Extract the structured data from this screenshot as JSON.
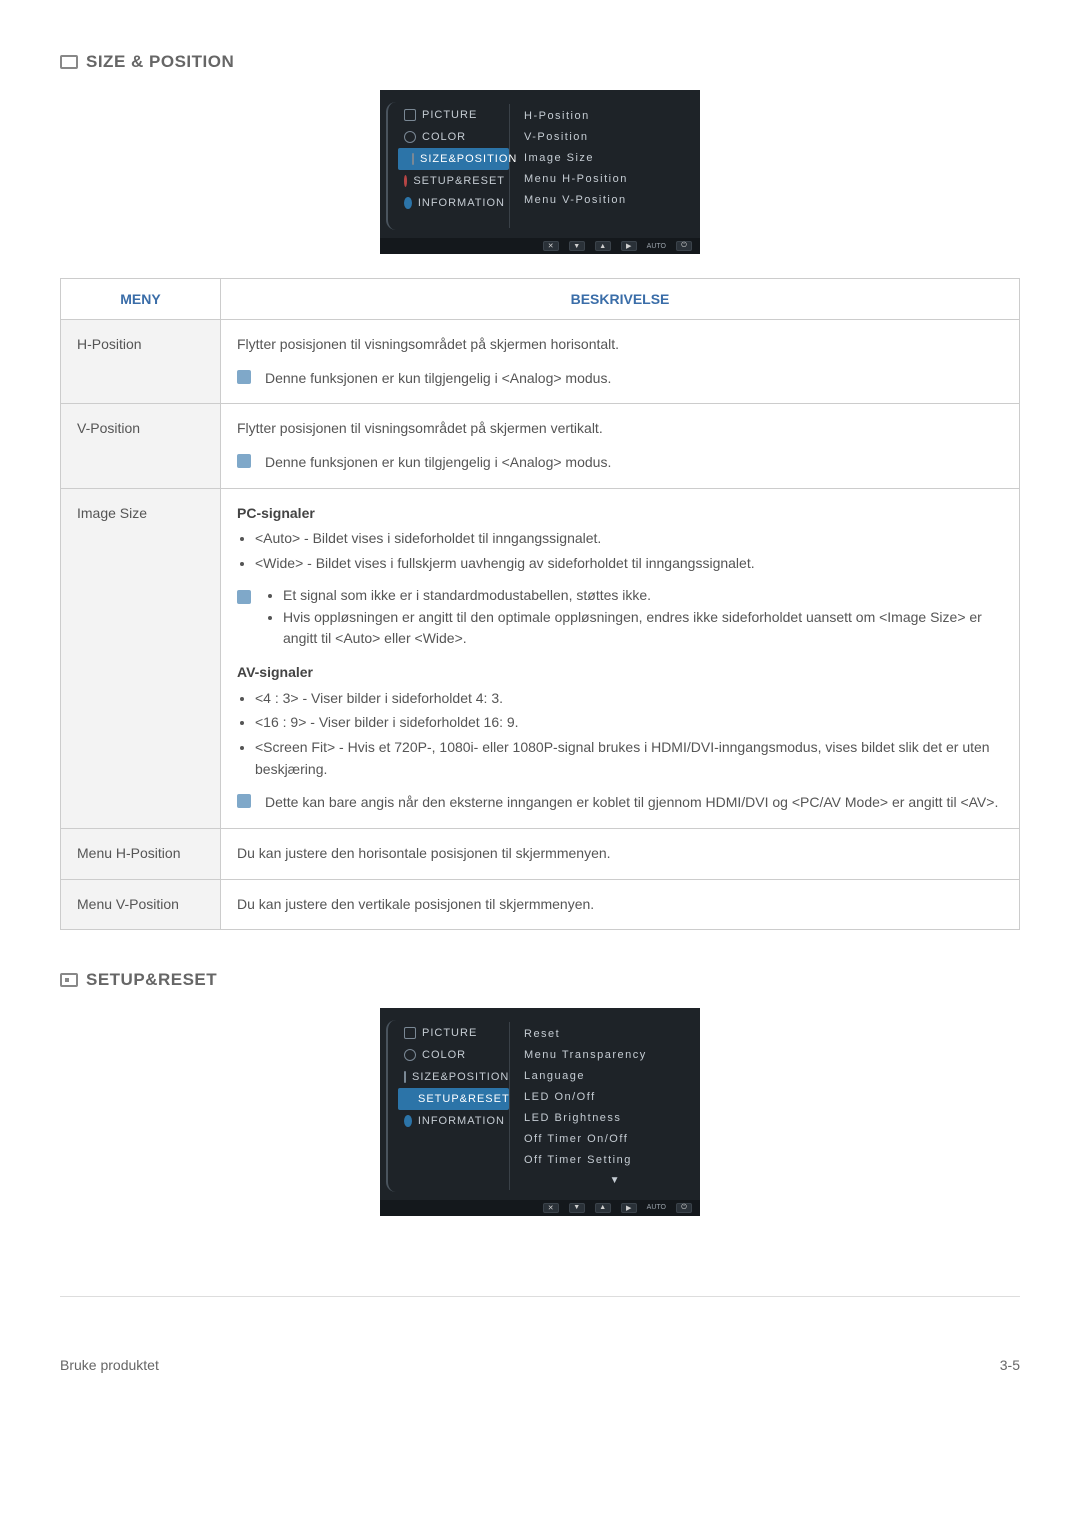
{
  "section1": {
    "title": "SIZE & POSITION"
  },
  "osd1": {
    "left": {
      "picture": "PICTURE",
      "color": "COLOR",
      "sizepos": "SIZE&POSITION",
      "setup": "SETUP&RESET",
      "info": "INFORMATION"
    },
    "right": {
      "hpos": "H-Position",
      "vpos": "V-Position",
      "imgsize": "Image Size",
      "menuh": "Menu H-Position",
      "menuv": "Menu V-Position"
    },
    "footer": {
      "auto": "AUTO"
    }
  },
  "table1": {
    "headers": {
      "meny": "MENY",
      "beskr": "BESKRIVELSE"
    },
    "rows": {
      "hpos": {
        "label": "H-Position",
        "text": "Flytter posisjonen til visningsområdet på skjermen horisontalt.",
        "note": "Denne funksjonen er kun tilgjengelig i <Analog> modus."
      },
      "vpos": {
        "label": "V-Position",
        "text": "Flytter posisjonen til visningsområdet på skjermen vertikalt.",
        "note": "Denne funksjonen er kun tilgjengelig i <Analog> modus."
      },
      "imgsize": {
        "label": "Image Size",
        "pc_header": "PC-signaler",
        "pc_b1": "<Auto> - Bildet vises i sideforholdet til inngangssignalet.",
        "pc_b2": "<Wide> - Bildet vises i fullskjerm uavhengig av sideforholdet til inngangssignalet.",
        "pc_n1": "Et signal som ikke er i standardmodustabellen, støttes ikke.",
        "pc_n2": "Hvis oppløsningen er angitt til den optimale oppløsningen, endres ikke sideforholdet uansett om <Image Size> er angitt til <Auto> eller <Wide>.",
        "av_header": "AV-signaler",
        "av_b1": "<4 : 3> - Viser bilder i sideforholdet 4: 3.",
        "av_b2": "<16 : 9> - Viser bilder i sideforholdet 16: 9.",
        "av_b3": "<Screen Fit> - Hvis et 720P-, 1080i- eller 1080P-signal brukes i HDMI/DVI-inngangsmodus, vises bildet slik det er uten beskjæring.",
        "av_note": "Dette kan bare angis når den eksterne inngangen er koblet til gjennom HDMI/DVI og <PC/AV Mode> er angitt til <AV>."
      },
      "menuh": {
        "label": "Menu H-Position",
        "text": "Du kan justere den horisontale posisjonen til skjermmenyen."
      },
      "menuv": {
        "label": "Menu V-Position",
        "text": "Du kan justere den vertikale posisjonen til skjermmenyen."
      }
    }
  },
  "section2": {
    "title": "SETUP&RESET"
  },
  "osd2": {
    "left": {
      "picture": "PICTURE",
      "color": "COLOR",
      "sizepos": "SIZE&POSITION",
      "setup": "SETUP&RESET",
      "info": "INFORMATION"
    },
    "right": {
      "reset": "Reset",
      "trans": "Menu Transparency",
      "lang": "Language",
      "led": "LED On/Off",
      "ledbr": "LED Brightness",
      "offt": "Off Timer On/Off",
      "offts": "Off Timer Setting"
    },
    "footer": {
      "auto": "AUTO"
    }
  },
  "footer": {
    "left": "Bruke produktet",
    "right": "3-5"
  }
}
